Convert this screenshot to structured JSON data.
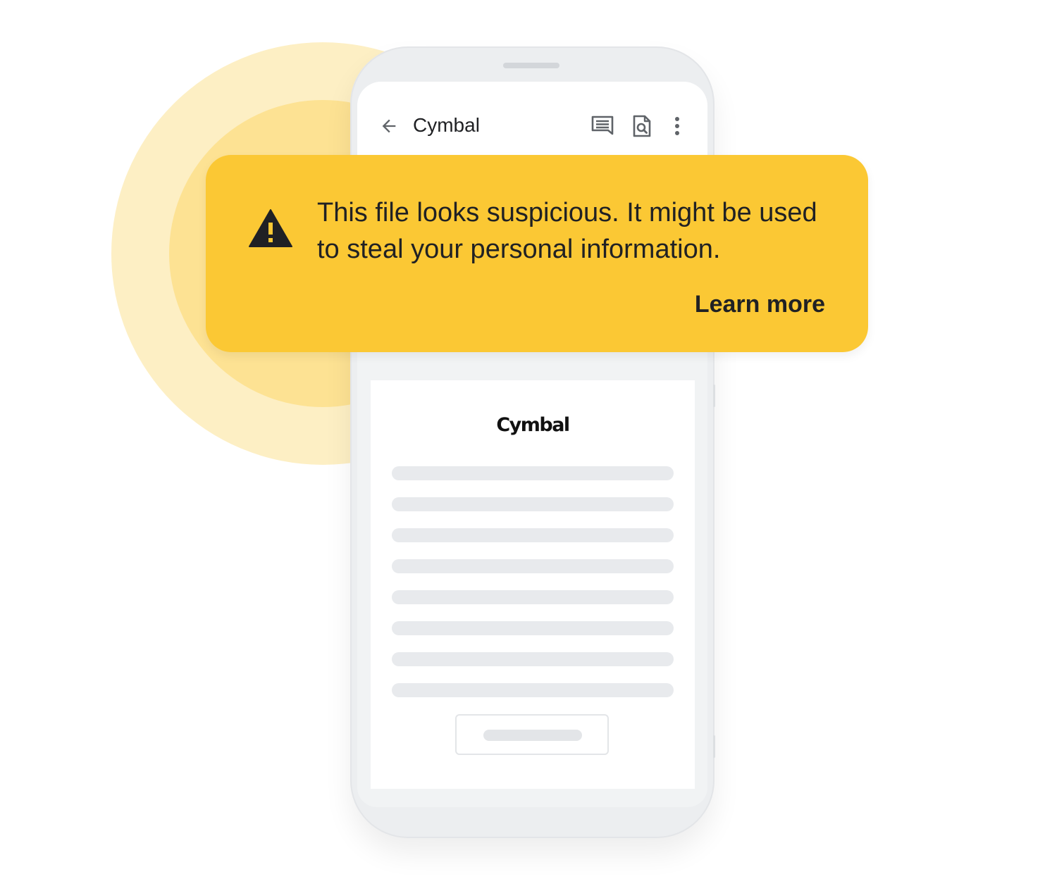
{
  "app_bar": {
    "title": "Cymbal",
    "icons": [
      "back-arrow-icon",
      "comment-icon",
      "file-search-icon",
      "more-vert-icon"
    ]
  },
  "alert": {
    "message": "This file looks suspicious. It might be used to steal your personal information.",
    "link_label": "Learn more",
    "icon": "warning-triangle-icon",
    "background_color": "#fbc834"
  },
  "document": {
    "logo_text": "Cymbal"
  },
  "colors": {
    "glow_outer": "#fdefc4",
    "glow_inner": "#fde293",
    "phone_body": "#eceef0",
    "placeholder_line": "#e8eaed"
  }
}
